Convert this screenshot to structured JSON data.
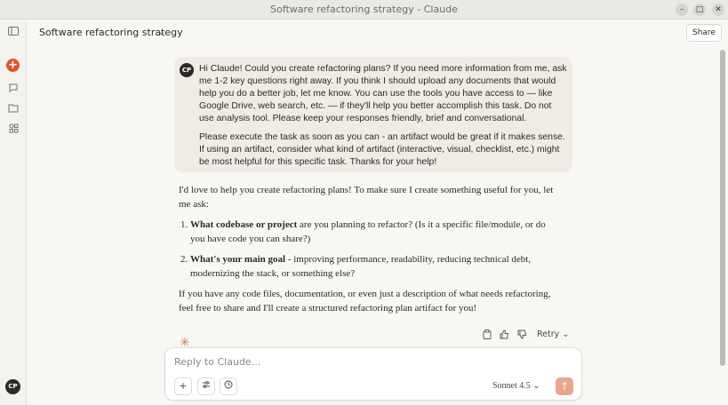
{
  "window": {
    "title": "Software refactoring strategy - Claude",
    "minimize_icon": "minimize-icon",
    "restore_icon": "restore-icon",
    "close_icon": "close-icon"
  },
  "sidebar": {
    "toggle_icon": "sidebar-toggle-icon",
    "new_chat_icon": "plus-icon",
    "chats_icon": "chat-bubble-icon",
    "projects_icon": "folder-icon",
    "artifacts_icon": "grid-icon",
    "user_initials": "CP"
  },
  "header": {
    "conversation_title": "Software refactoring strategy",
    "share_label": "Share"
  },
  "user_message": {
    "initials": "CP",
    "paragraph_1": "Hi Claude! Could you create refactoring plans? If you need more information from me, ask me 1-2 key questions right away. If you think I should upload any documents that would help you do a better job, let me know. You can use the tools you have access to — like Google Drive, web search, etc. — if they'll help you better accomplish this task. Do not use analysis tool. Please keep your responses friendly, brief and conversational.",
    "paragraph_2": "Please execute the task as soon as you can - an artifact would be great if it makes sense. If using an artifact, consider what kind of artifact (interactive, visual, checklist, etc.) might be most helpful for this specific task. Thanks for your help!"
  },
  "assistant_message": {
    "intro": "I'd love to help you create refactoring plans! To make sure I create something useful for you, let me ask:",
    "questions": [
      {
        "bold": "What codebase or project",
        "rest": " are you planning to refactor? (Is it a specific file/module, or do you have code you can share?)"
      },
      {
        "bold": "What's your main goal",
        "rest": " - improving performance, readability, reducing technical debt, modernizing the stack, or something else?"
      }
    ],
    "outro": "If you have any code files, documentation, or even just a description of what needs refactoring, feel free to share and I'll create a structured refactoring plan artifact for you!"
  },
  "actions": {
    "copy_icon": "copy-icon",
    "thumbs_up_icon": "thumbs-up-icon",
    "thumbs_down_icon": "thumbs-down-icon",
    "retry_label": "Retry"
  },
  "composer": {
    "placeholder": "Reply to Claude...",
    "model_label": "Sonnet 4.5"
  },
  "colors": {
    "accent": "#e3542b",
    "send_button": "#eaa58a",
    "user_bubble": "#efece6",
    "background": "#f8f7f3"
  }
}
